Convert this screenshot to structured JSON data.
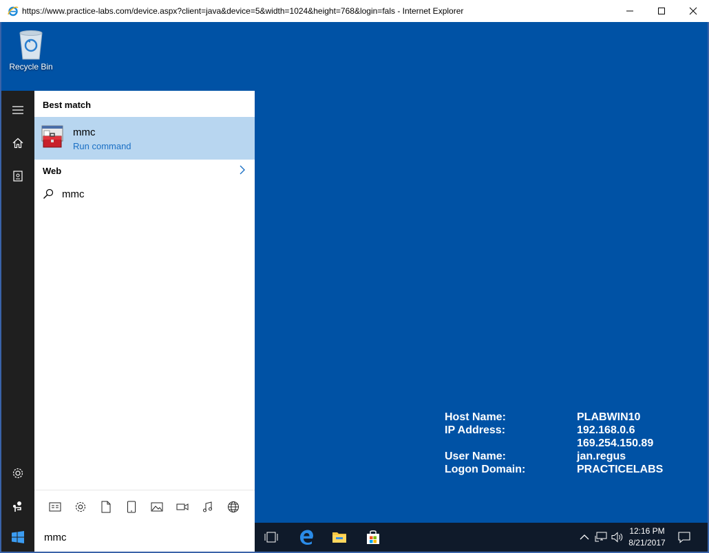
{
  "browser": {
    "title": "https://www.practice-labs.com/device.aspx?client=java&device=5&width=1024&height=768&login=fals - Internet Explorer"
  },
  "desktop": {
    "recycle_bin_label": "Recycle Bin",
    "background_color": "#0052a5"
  },
  "host_info": [
    {
      "key": "Host Name:",
      "value": "PLABWIN10"
    },
    {
      "key": "IP Address:",
      "value": "192.168.0.6"
    },
    {
      "key": "",
      "value": "169.254.150.89"
    },
    {
      "key": "User Name:",
      "value": "jan.regus"
    },
    {
      "key": "Logon Domain:",
      "value": "PRACTICELABS"
    }
  ],
  "start_menu": {
    "best_match_heading": "Best match",
    "best_match": {
      "name": "mmc",
      "subtitle": "Run command"
    },
    "web_heading": "Web",
    "web_suggestion": "mmc",
    "filter_icons": [
      "apps-icon",
      "settings-icon",
      "documents-icon",
      "tablet-icon",
      "photos-icon",
      "videos-icon",
      "music-icon",
      "web-icon"
    ]
  },
  "taskbar": {
    "search_value": "mmc",
    "time": "12:16 PM",
    "date": "8/21/2017"
  },
  "colors": {
    "selection": "#b8d6f0",
    "link_blue": "#1a6fc4",
    "rail": "#1f1f1f"
  }
}
